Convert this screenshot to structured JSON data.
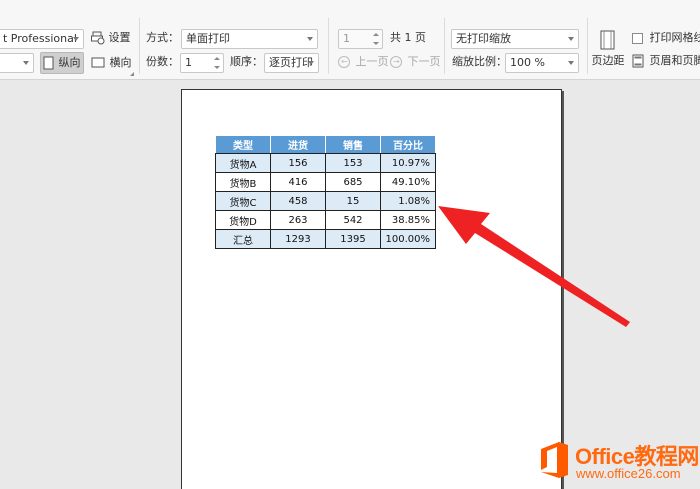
{
  "toolbar": {
    "printer_value": "t Professional",
    "settings_label": "设置",
    "portrait_label": "纵向",
    "landscape_label": "横向",
    "mode_label": "方式：",
    "mode_value": "单面打印",
    "copies_label": "份数：",
    "copies_value": "1",
    "order_label": "顺序：",
    "order_value": "逐页打印",
    "page_value": "1",
    "total_label": "共 1 页",
    "prev_label": "上一页",
    "next_label": "下一页",
    "scale_value": "无打印缩放",
    "zoom_label": "缩放比例：",
    "zoom_value": "100 %",
    "margins_label": "页边距",
    "gridlines_label": "打印网格线",
    "header_footer_label": "页眉和页脚"
  },
  "sheet": {
    "headers": [
      "类型",
      "进货",
      "销售",
      "百分比"
    ],
    "rows": [
      [
        "货物A",
        "156",
        "153",
        "10.97%"
      ],
      [
        "货物B",
        "416",
        "685",
        "49.10%"
      ],
      [
        "货物C",
        "458",
        "15",
        "1.08%"
      ],
      [
        "货物D",
        "263",
        "542",
        "38.85%"
      ],
      [
        "汇总",
        "1293",
        "1395",
        "100.00%"
      ]
    ]
  },
  "watermark": {
    "line1": "Office教程网",
    "line2": "www.office26.com"
  },
  "colors": {
    "header_blue": "#5b9bd5",
    "band_blue": "#ddebf7",
    "arrow_red": "#ee2222",
    "brand_orange": "#ff6a10"
  }
}
